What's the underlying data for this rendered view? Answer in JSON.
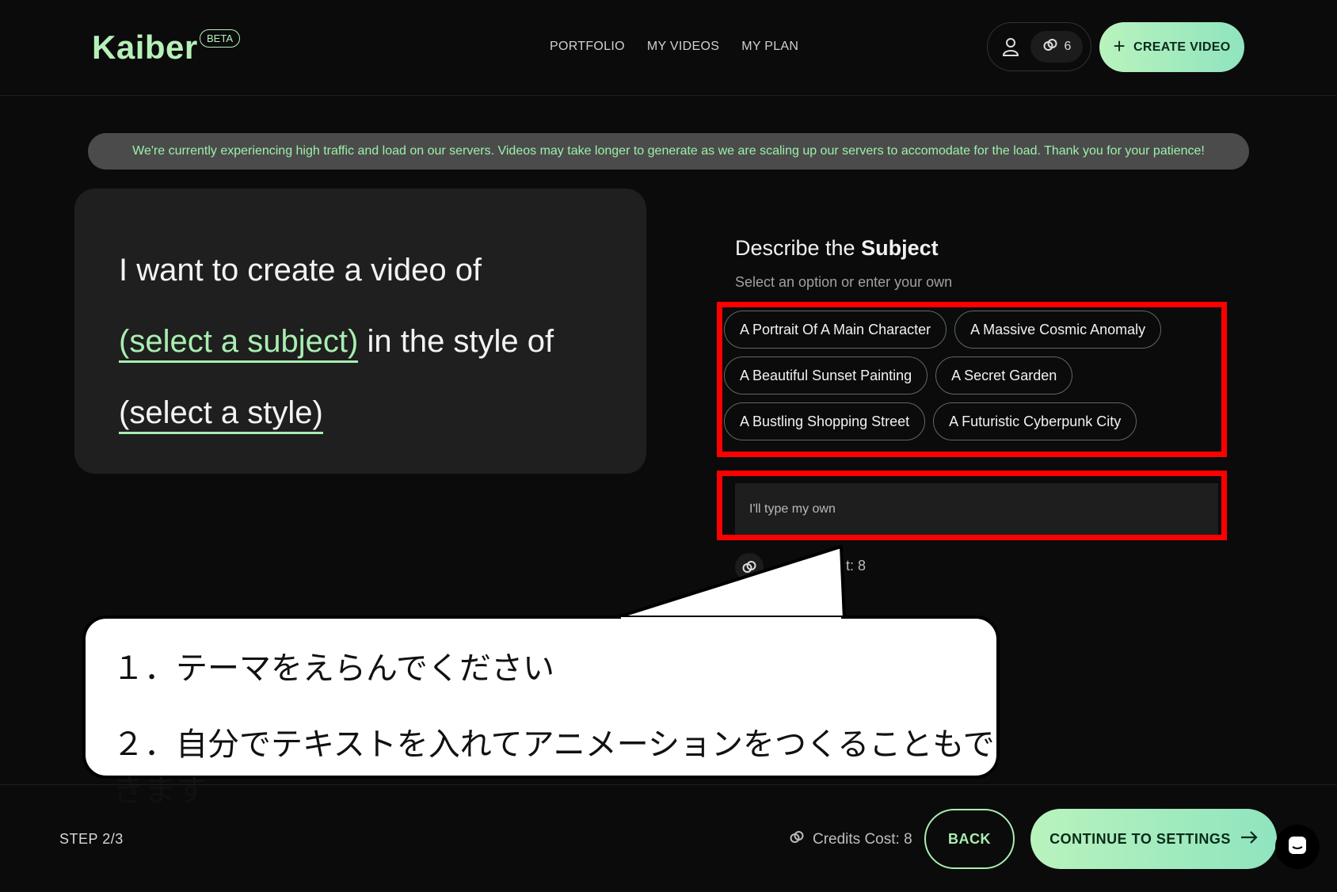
{
  "header": {
    "logo": "Kaiber",
    "badge": "BETA",
    "nav": [
      "PORTFOLIO",
      "MY VIDEOS",
      "MY PLAN"
    ],
    "credits_count": "6",
    "create_label": "CREATE VIDEO"
  },
  "banner": "We're currently experiencing high traffic and load on our servers. Videos may take longer to generate as we are scaling up our servers to accomodate for the load. Thank you for your patience!",
  "card": {
    "line1": "I want to create a video of",
    "subject_placeholder": "(select a subject)",
    "middle": " in the style of",
    "style_placeholder": "(select a style)"
  },
  "panel": {
    "title_prefix": "Describe the ",
    "title_bold": "Subject",
    "subtitle": "Select an option or enter your own",
    "options": [
      [
        "A Portrait Of A Main Character",
        "A Massive Cosmic Anomaly"
      ],
      [
        "A Beautiful Sunset Painting",
        "A Secret Garden"
      ],
      [
        "A Bustling Shopping Street",
        "A Futuristic Cyberpunk City"
      ]
    ],
    "input_placeholder": "I'll type my own",
    "mini_cost": "t: 8"
  },
  "callout": {
    "line1": "１．テーマをえらんでください",
    "line2": "２．自分でテキストを入れてアニメーションをつくることもできます"
  },
  "footer": {
    "step": "STEP 2/3",
    "cost": "Credits Cost: 8",
    "back": "BACK",
    "continue": "CONTINUE TO SETTINGS"
  },
  "colors": {
    "accent": "#a8eeb0",
    "highlight_box": "#ff0000",
    "background": "#0b0b0b"
  },
  "icons": [
    "user-icon",
    "credits-icon",
    "plus-icon",
    "arrow-right-icon",
    "chat-icon"
  ]
}
